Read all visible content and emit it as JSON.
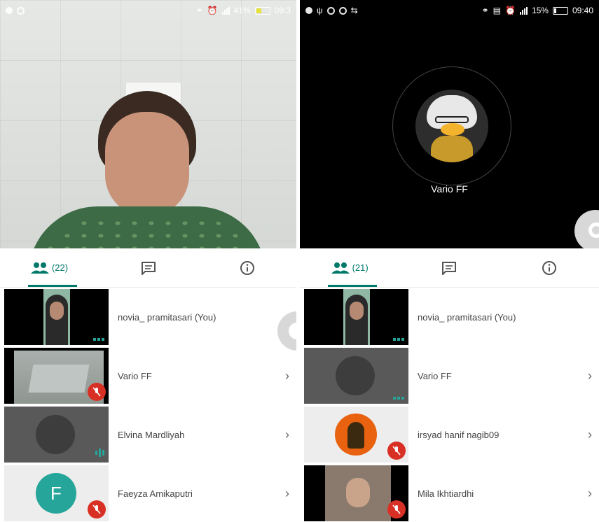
{
  "left": {
    "status_time": "09:3",
    "battery_text": "41%",
    "battery_level": 0.41,
    "battery_color": "#e6e23a",
    "people_count": "(22)",
    "participants": [
      {
        "name": "novia_ pramitasari (You)",
        "indicator": "dots"
      },
      {
        "name": "Vario FF",
        "indicator": "mic-off"
      },
      {
        "name": "Elvina Mardliyah",
        "indicator": "speaking"
      },
      {
        "name": "Faeyza Amikaputri",
        "indicator": "mic-off",
        "initial": "F"
      }
    ]
  },
  "right": {
    "status_time": "09:40",
    "battery_text": "15%",
    "battery_level": 0.15,
    "battery_color": "#ffffff",
    "speaker_name": "Vario FF",
    "people_count": "(21)",
    "participants": [
      {
        "name": "novia_ pramitasari (You)",
        "indicator": "dots"
      },
      {
        "name": "Vario FF",
        "indicator": "dots"
      },
      {
        "name": "irsyad hanif nagib09",
        "indicator": "mic-off"
      },
      {
        "name": "Mila Ikhtiardhi",
        "indicator": "mic-off"
      }
    ]
  },
  "colors": {
    "accent": "#00796b",
    "mic_off": "#d93025",
    "avatar_teal": "#26a69a"
  },
  "icons": {
    "people_tab": "people-icon",
    "chat_tab": "chat-icon",
    "info_tab": "info-icon",
    "row_chevron": "chevron-right-icon"
  }
}
